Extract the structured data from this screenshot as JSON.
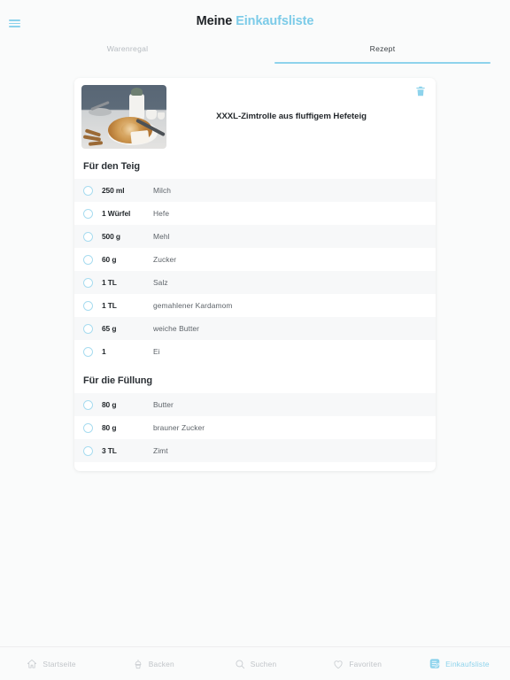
{
  "header": {
    "menu_icon": "hamburger-menu-icon",
    "title_primary": "Meine",
    "title_accent": "Einkaufsliste"
  },
  "tabs": [
    {
      "label": "Warenregal",
      "active": false
    },
    {
      "label": "Rezept",
      "active": true
    }
  ],
  "recipe": {
    "title": "XXXL-Zimtrolle aus fluffigem Hefeteig",
    "image_alt": "XXXL-Zimtrolle Kuchen auf Teller mit Zimtstangen",
    "delete_icon": "trash-icon",
    "sections": [
      {
        "heading": "Für den Teig",
        "ingredients": [
          {
            "quantity": "250 ml",
            "name": "Milch"
          },
          {
            "quantity": "1 Würfel",
            "name": "Hefe"
          },
          {
            "quantity": "500 g",
            "name": "Mehl"
          },
          {
            "quantity": "60 g",
            "name": "Zucker"
          },
          {
            "quantity": "1 TL",
            "name": "Salz"
          },
          {
            "quantity": "1 TL",
            "name": "gemahlener Kardamom"
          },
          {
            "quantity": "65 g",
            "name": "weiche Butter"
          },
          {
            "quantity": "1",
            "name": "Ei"
          }
        ]
      },
      {
        "heading": "Für die Füllung",
        "ingredients": [
          {
            "quantity": "80 g",
            "name": "Butter"
          },
          {
            "quantity": "80 g",
            "name": "brauner Zucker"
          },
          {
            "quantity": "3 TL",
            "name": "Zimt"
          }
        ]
      }
    ]
  },
  "bottom_nav": [
    {
      "label": "Startseite",
      "icon": "home-icon",
      "active": false
    },
    {
      "label": "Backen",
      "icon": "cupcake-icon",
      "active": false
    },
    {
      "label": "Suchen",
      "icon": "search-icon",
      "active": false
    },
    {
      "label": "Favoriten",
      "icon": "heart-icon",
      "active": false
    },
    {
      "label": "Einkaufsliste",
      "icon": "shopping-list-icon",
      "active": true
    }
  ],
  "colors": {
    "accent": "#8ed3ec",
    "title_dark": "#1e2226",
    "page_background": "#fafbfb",
    "card_background": "#ffffff",
    "row_stripe": "#f7f8f9",
    "inactive_text": "#c0c4c8"
  }
}
